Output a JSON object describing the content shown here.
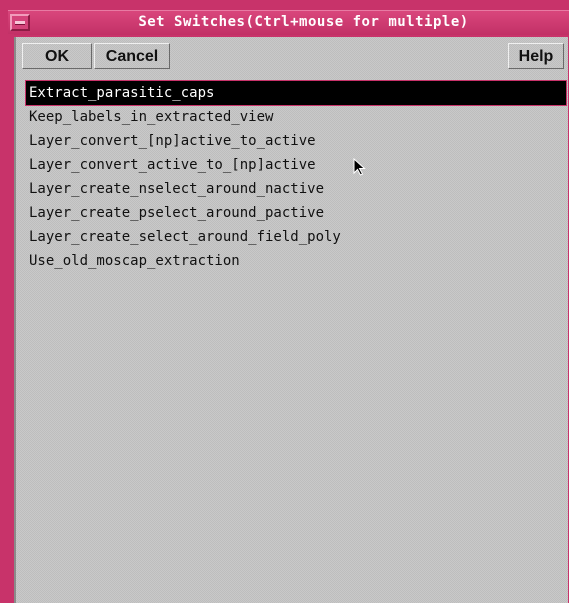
{
  "window": {
    "title": "Set Switches(Ctrl+mouse for multiple)"
  },
  "toolbar": {
    "ok_label": "OK",
    "cancel_label": "Cancel",
    "help_label": "Help"
  },
  "switches": {
    "items": [
      {
        "label": "Extract_parasitic_caps",
        "selected": true
      },
      {
        "label": "Keep_labels_in_extracted_view",
        "selected": false
      },
      {
        "label": "Layer_convert_[np]active_to_active",
        "selected": false
      },
      {
        "label": "Layer_convert_active_to_[np]active",
        "selected": false
      },
      {
        "label": "Layer_create_nselect_around_nactive",
        "selected": false
      },
      {
        "label": "Layer_create_pselect_around_pactive",
        "selected": false
      },
      {
        "label": "Layer_create_select_around_field_poly",
        "selected": false
      },
      {
        "label": "Use_old_moscap_extraction",
        "selected": false
      }
    ]
  },
  "colors": {
    "frame": "#c8336a",
    "selection_bg": "#000000",
    "selection_text": "#ffffff",
    "panel_bg": "#c9c9c9"
  },
  "icons": {
    "window_menu": "window-menu-icon",
    "pointer": "mouse-pointer-icon"
  }
}
